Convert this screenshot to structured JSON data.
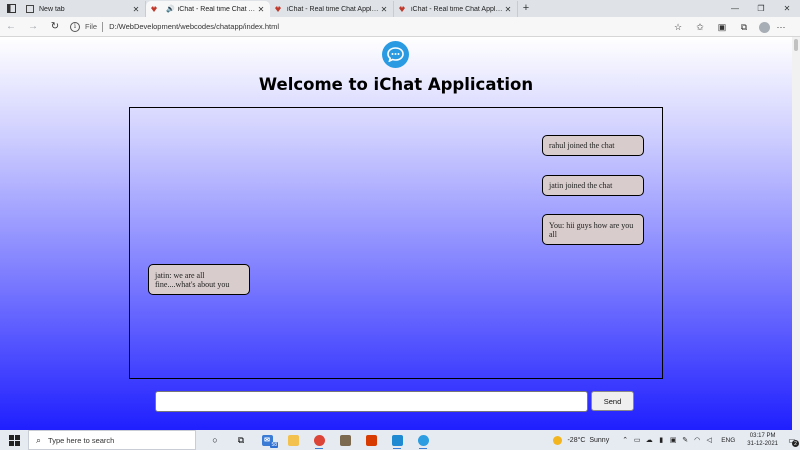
{
  "browser": {
    "tabs": [
      {
        "title": "New tab",
        "active": false,
        "audio": false
      },
      {
        "title": "iChat - Real time Chat Application",
        "active": true,
        "audio": true
      },
      {
        "title": "iChat - Real time Chat Application",
        "active": false,
        "audio": false
      },
      {
        "title": "iChat - Real time Chat Application",
        "active": false,
        "audio": false
      }
    ],
    "address": {
      "scheme_label": "File",
      "url": "D:/WebDevelopment/webcodes/chatapp/index.html"
    }
  },
  "page": {
    "title": "Welcome to iChat Application",
    "messages": [
      {
        "text": "rahul joined the chat",
        "side": "right"
      },
      {
        "text": "jatin joined the chat",
        "side": "right"
      },
      {
        "text": "You: hii guys how are you all",
        "side": "right"
      },
      {
        "text": "jatin: we are all fine....what's about you",
        "side": "left"
      }
    ],
    "input": {
      "value": "",
      "placeholder": ""
    },
    "send_label": "Send"
  },
  "taskbar": {
    "search_placeholder": "Type here to search",
    "badge_count": "58",
    "weather": {
      "temp": "-28°C",
      "condition": "Sunny"
    },
    "language": "ENG",
    "time": "03:17 PM",
    "date": "31-12-2021",
    "notification_count": "2"
  },
  "colors": {
    "accent_logo": "#2a9ae3",
    "message_bg": "#d8cccc",
    "gradient_bottom": "#1f1fff"
  }
}
